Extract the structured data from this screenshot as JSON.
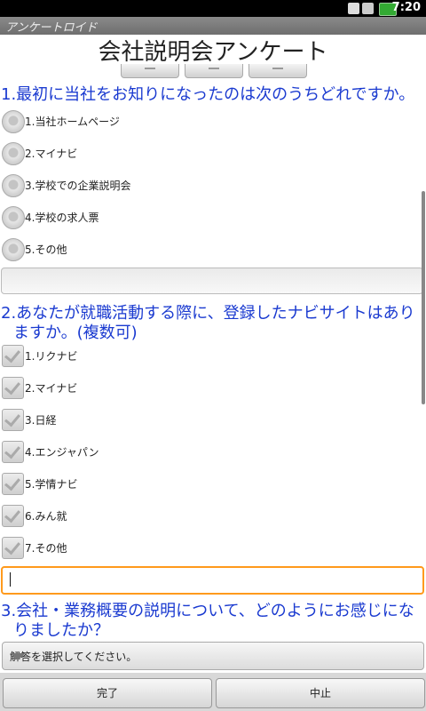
{
  "status_bar": {
    "time": "7:20",
    "icons": [
      "wifi-icon",
      "mute-icon",
      "battery-icon"
    ]
  },
  "app_title": "アンケートロイド",
  "page_title": "会社説明会アンケート",
  "q1": {
    "text": "1.最初に当社をお知りになったのは次のうちどれですか。",
    "options": [
      "1.当社ホームページ",
      "2.マイナビ",
      "3.学校での企業説明会",
      "4.学校の求人票",
      "5.その他"
    ],
    "other_value": ""
  },
  "q2": {
    "text_line1": "2.あなたが就職活動する際に、登録したナビサイトはあり",
    "text_line2": "ますか。(複数可)",
    "options": [
      "1.リクナビ",
      "2.マイナビ",
      "3.日経",
      "4.エンジャパン",
      "5.学情ナビ",
      "6.みん就",
      "7.その他"
    ],
    "other_value": ""
  },
  "q3": {
    "text_line1": "3.会社・業務概要の説明について、どのようにお感じにな",
    "text_line2": "りましたか？",
    "select_placeholder": "解答を選択してください。"
  },
  "buttons": {
    "done": "完了",
    "cancel": "中止"
  },
  "colors": {
    "question": "#1a3ad0",
    "focus": "#ff9a1c"
  }
}
